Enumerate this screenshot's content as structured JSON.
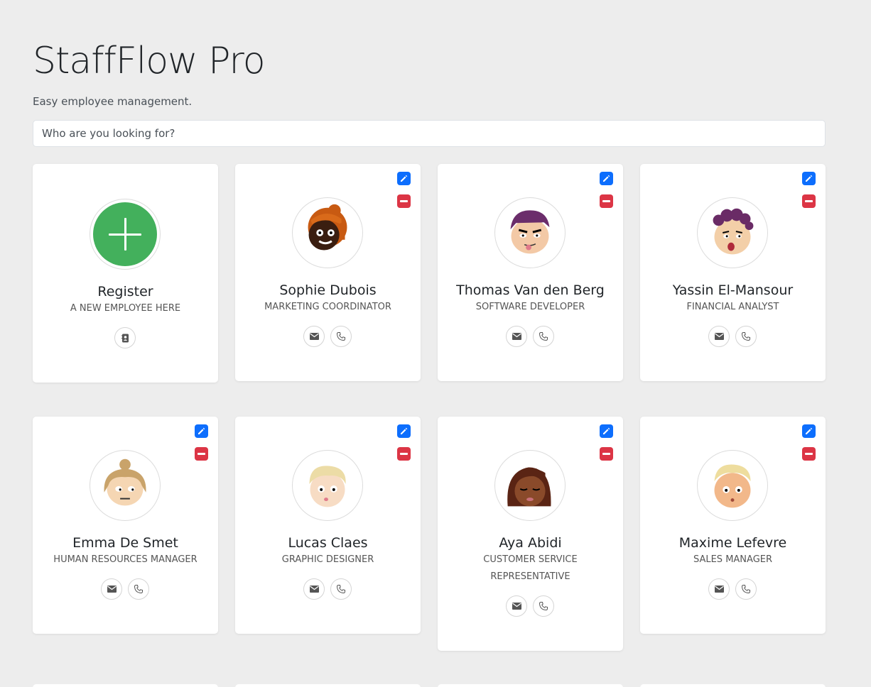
{
  "header": {
    "title": "StaffFlow Pro",
    "subtitle": "Easy employee management."
  },
  "search": {
    "placeholder": "Who are you looking for?"
  },
  "register_card": {
    "name": "Register",
    "subtitle": "A NEW EMPLOYEE HERE",
    "icon": "contact-book-icon"
  },
  "employees": [
    {
      "name": "Sophie Dubois",
      "role": "MARKETING COORDINATOR"
    },
    {
      "name": "Thomas Van den Berg",
      "role": "SOFTWARE DEVELOPER"
    },
    {
      "name": "Yassin El-Mansour",
      "role": "FINANCIAL ANALYST"
    },
    {
      "name": "Emma De Smet",
      "role": "HUMAN RESOURCES MANAGER"
    },
    {
      "name": "Lucas Claes",
      "role": "GRAPHIC DESIGNER"
    },
    {
      "name": "Aya Abidi",
      "role": "CUSTOMER SERVICE REPRESENTATIVE"
    },
    {
      "name": "Maxime Lefevre",
      "role": "SALES MANAGER"
    }
  ],
  "colors": {
    "edit": "#0d6efd",
    "delete": "#dc3545",
    "register": "#43b05c",
    "background": "#ededed"
  }
}
